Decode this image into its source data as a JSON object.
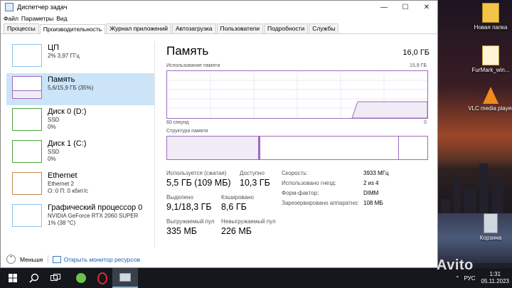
{
  "window": {
    "title": "Диспетчер задач",
    "menu": [
      "Файл",
      "Параметры",
      "Вид"
    ],
    "tabs": [
      {
        "label": "Процессы",
        "active": false
      },
      {
        "label": "Производительность",
        "active": true
      },
      {
        "label": "Журнал приложений",
        "active": false
      },
      {
        "label": "Автозагрузка",
        "active": false
      },
      {
        "label": "Пользователи",
        "active": false
      },
      {
        "label": "Подробности",
        "active": false
      },
      {
        "label": "Службы",
        "active": false
      }
    ]
  },
  "sidebar": {
    "items": [
      {
        "name": "ЦП",
        "sub1": "2%  3,97 ГГц",
        "sub2": "",
        "kind": "cpu"
      },
      {
        "name": "Память",
        "sub1": "5,6/15,9 ГБ (35%)",
        "sub2": "",
        "kind": "mem",
        "selected": true
      },
      {
        "name": "Диск 0 (D:)",
        "sub1": "SSD",
        "sub2": "0%",
        "kind": "disk"
      },
      {
        "name": "Диск 1 (C:)",
        "sub1": "SSD",
        "sub2": "0%",
        "kind": "disk"
      },
      {
        "name": "Ethernet",
        "sub1": "Ethernet 2",
        "sub2": "О: 0  П: 0 кбит/с",
        "kind": "eth"
      },
      {
        "name": "Графический процессор 0",
        "sub1": "NVIDIA GeForce RTX 2060 SUPER",
        "sub2": "1%  (38 °C)",
        "kind": "gpu"
      }
    ]
  },
  "main": {
    "title": "Память",
    "total": "16,0 ГБ",
    "usage_label": "Использование памяти",
    "usage_max": "15,9 ГБ",
    "axis_left": "60 секунд",
    "axis_right": "0",
    "composition_label": "Структура памяти",
    "stats": {
      "in_use_label": "Используется (сжатая)",
      "in_use_value": "5,5 ГБ (109 МБ)",
      "available_label": "Доступно",
      "available_value": "10,3 ГБ",
      "committed_label": "Выделено",
      "committed_value": "9,1/18,3 ГБ",
      "cached_label": "Кэшировано",
      "cached_value": "8,6 ГБ",
      "paged_label": "Выгружаемый пул",
      "paged_value": "335 МБ",
      "nonpaged_label": "Невыгружаемый пул",
      "nonpaged_value": "226 МБ"
    },
    "details": {
      "speed_label": "Скорость:",
      "speed_value": "3933 МГц",
      "slots_label": "Использовано гнезд:",
      "slots_value": "2 из 4",
      "form_label": "Форм-фактор:",
      "form_value": "DIMM",
      "reserved_label": "Зарезервировано аппаратно:",
      "reserved_value": "108 МБ"
    }
  },
  "footer": {
    "less": "Меньше",
    "monitor": "Открыть монитор ресурсов"
  },
  "desktop": {
    "icons": [
      "Новая папка",
      "FurMark_win...",
      "VLC media player",
      "Корзина"
    ]
  },
  "taskbar": {
    "language": "РУС",
    "time": "1:31",
    "date": "05.11.2023"
  },
  "watermark": "Avito",
  "colors": {
    "selection": "#cce4f7",
    "memory": "#9b6bbf",
    "link": "#1a5fb4"
  }
}
